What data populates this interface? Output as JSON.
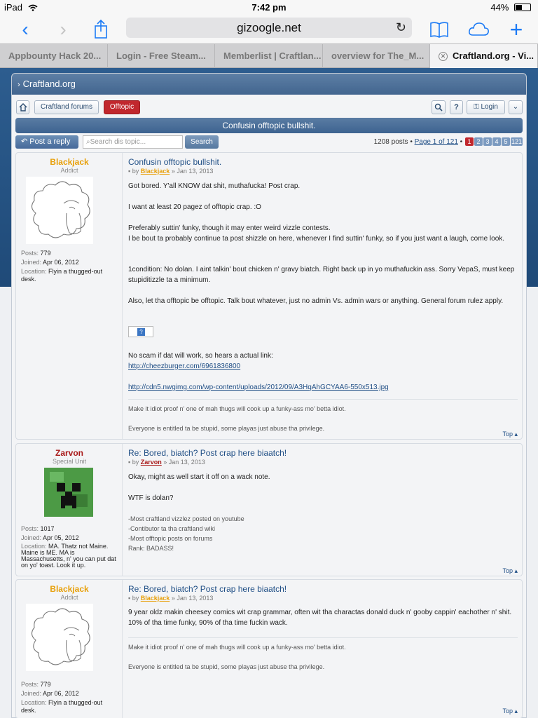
{
  "status_bar": {
    "device": "iPad",
    "time": "7:42 pm",
    "battery": "44%"
  },
  "browser": {
    "url": "gizoogle.net",
    "tabs": [
      {
        "label": "Appbounty Hack 20..."
      },
      {
        "label": "Login - Free Steam..."
      },
      {
        "label": "Memberlist | Craftlan..."
      },
      {
        "label": "overview for The_M..."
      },
      {
        "label": "Craftland.org - Vi..."
      }
    ]
  },
  "forum": {
    "site": "Craftland.org",
    "crumbs": {
      "forums": "Craftland forums",
      "current": "Offtopic"
    },
    "login": "Login",
    "topic_title": "Confusin offtopic bullshit.",
    "reply": "Post a reply",
    "search_placeholder": "Search dis topic...",
    "search_button": "Search",
    "pagination": {
      "count": "1208 posts",
      "page_label": "Page 1 of 121",
      "pages": [
        "1",
        "2",
        "3",
        "4",
        "5",
        "121"
      ]
    }
  },
  "posts": [
    {
      "author": "Blackjack",
      "rank": "Addict",
      "author_color": "#e8a00a",
      "posts_label": "Posts:",
      "posts": "779",
      "joined_label": "Joined:",
      "joined": "Apr 06, 2012",
      "location_label": "Location:",
      "location": "Flyin a thugged-out desk.",
      "title": "Confusin offtopic bullshit.",
      "by": "by",
      "date": "» Jan 13, 2013",
      "p1": "Got bored. Y'all KNOW dat shit, muthafucka! Post crap.",
      "p2": "I want at least 20 pagez of offtopic crap. :O",
      "p3a": "Preferably suttin' funky, though it may enter weird vizzle contests.",
      "p3b": "I be bout ta probably continue ta post shizzle on here, whenever I find suttin' funky, so if you just want a laugh, come look.",
      "p4": "1condition: No dolan. I aint talkin' bout chicken n' gravy biatch. Right back up in yo muthafuckin ass. Sorry VepaS, must keep stupiditizzle ta a minimum.",
      "p5": "Also, let tha offtopic be offtopic. Talk bout whatever, just no admin Vs. admin wars or anything. General forum rulez apply.",
      "p6": "No scam if dat will work, so hears a actual link:",
      "link1": "http://cheezburger.com/6961836800",
      "link2": "http://cdn5.nwgimg.com/wp-content/uploads/2012/09/A3HqAhGCYAA6-550x513.jpg",
      "sig1": "Make it idiot proof n' one of mah thugs will cook up a funky-ass mo' betta idiot.",
      "sig2": "Everyone is entitled ta be stupid, some playas just abuse tha privilege.",
      "top": "Top"
    },
    {
      "author": "Zarvon",
      "rank": "Special Unit",
      "author_color": "#a81818",
      "posts_label": "Posts:",
      "posts": "1017",
      "joined_label": "Joined:",
      "joined": "Apr 05, 2012",
      "location_label": "Location:",
      "location": "MA. Thatz not Maine. Maine is ME. MA is Massachusetts, n' you can put dat on yo' toast. Look it up.",
      "title": "Re: Bored, biatch? Post crap here biaatch!",
      "by": "by",
      "date": "» Jan 13, 2013",
      "p1": "Okay, might as well start it off on a wack note.",
      "p2": "WTF is dolan?",
      "sig1": "-Most craftland vizzlez posted on youtube",
      "sig2": "-Contibutor ta tha craftland wiki",
      "sig3": "-Most offtopic posts on forums",
      "sig4": "Rank: BADASS!",
      "top": "Top"
    },
    {
      "author": "Blackjack",
      "rank": "Addict",
      "author_color": "#e8a00a",
      "posts_label": "Posts:",
      "posts": "779",
      "joined_label": "Joined:",
      "joined": "Apr 06, 2012",
      "location_label": "Location:",
      "location": "Flyin a thugged-out desk.",
      "title": "Re: Bored, biatch? Post crap here biaatch!",
      "by": "by",
      "date": "» Jan 13, 2013",
      "p1": "9 year oldz makin cheesey comics wit crap grammar, often wit tha charactas donald duck n' gooby cappin' eachother n' shit. 10% of tha time funky, 90% of tha time fuckin wack.",
      "sig1": "Make it idiot proof n' one of mah thugs will cook up a funky-ass mo' betta idiot.",
      "sig2": "Everyone is entitled ta be stupid, some playas just abuse tha privilege.",
      "top": "Top"
    }
  ]
}
